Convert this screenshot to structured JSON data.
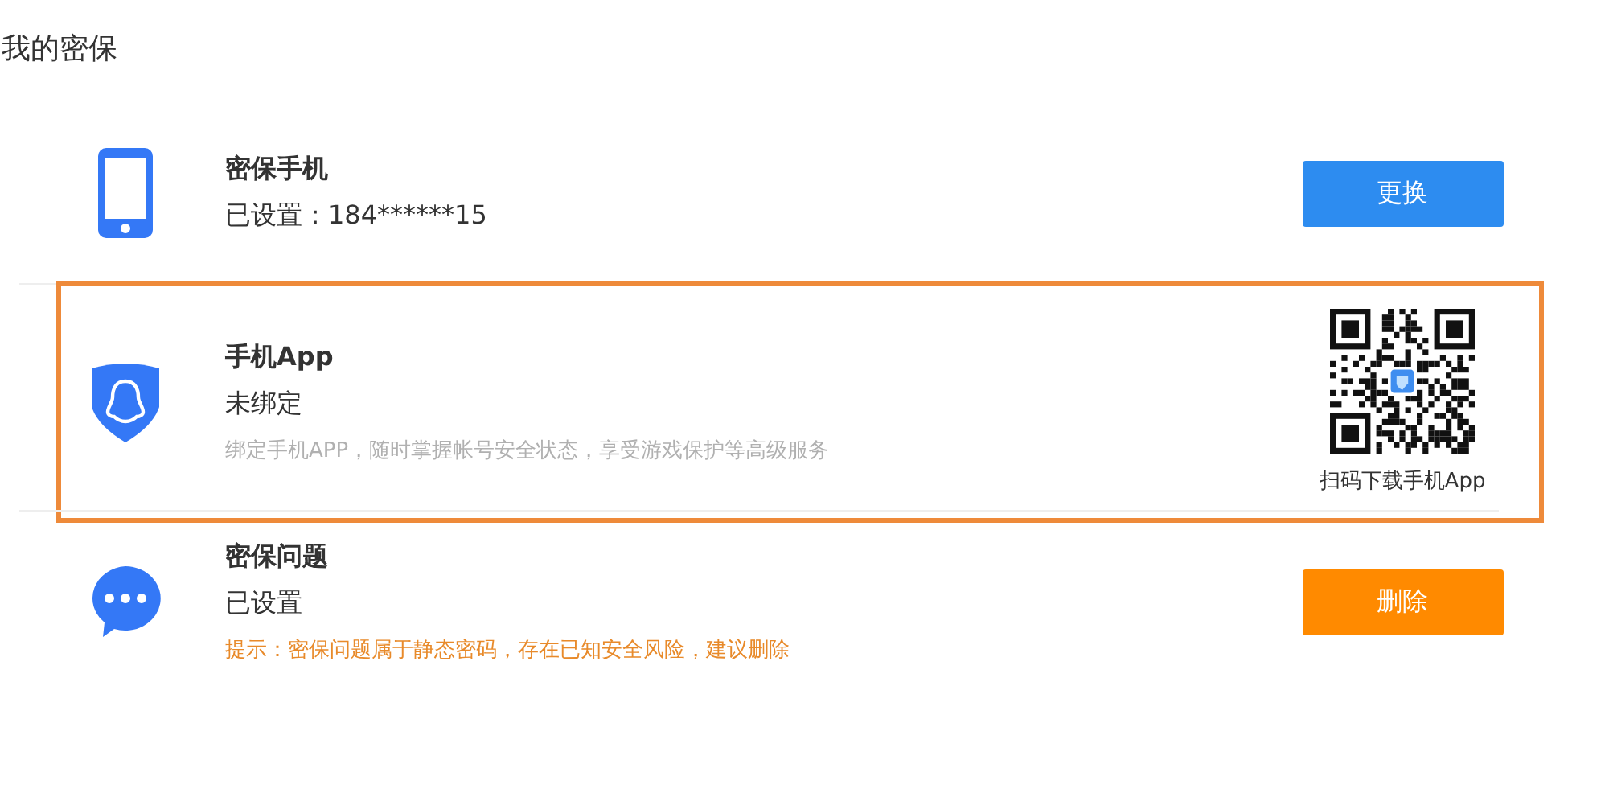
{
  "title": "我的密保",
  "items": [
    {
      "kind": "phone",
      "name": "密保手机",
      "status": "已设置：184******15",
      "highlighted": false,
      "action": {
        "kind": "button",
        "label": "更换",
        "color": "#2d8cf0"
      }
    },
    {
      "kind": "app",
      "name": "手机App",
      "status": "未绑定",
      "note": {
        "kind": "hint",
        "text": "绑定手机APP，随时掌握帐号安全状态，享受游戏保护等高级服务"
      },
      "highlighted": true,
      "action": {
        "kind": "qr",
        "caption": "扫码下载手机App"
      }
    },
    {
      "kind": "question",
      "name": "密保问题",
      "status": "已设置",
      "note": {
        "kind": "warning",
        "text": "提示：密保问题属于静态密码，存在已知安全风险，建议删除"
      },
      "highlighted": false,
      "action": {
        "kind": "button",
        "label": "删除",
        "color": "#ff8a00"
      }
    }
  ]
}
